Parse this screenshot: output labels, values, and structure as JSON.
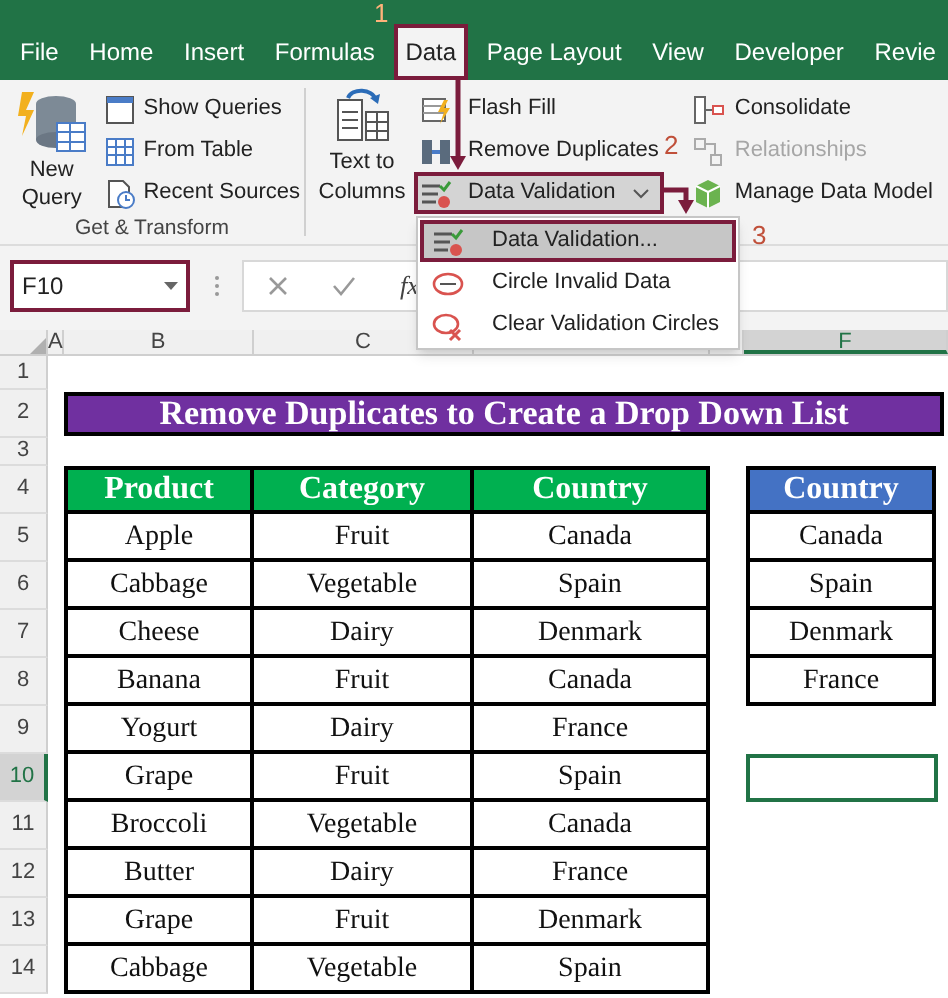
{
  "ribbon_tabs": [
    {
      "label": "File",
      "selected": false
    },
    {
      "label": "Home",
      "selected": false
    },
    {
      "label": "Insert",
      "selected": false
    },
    {
      "label": "Formulas",
      "selected": false
    },
    {
      "label": "Data",
      "selected": true
    },
    {
      "label": "Page Layout",
      "selected": false
    },
    {
      "label": "View",
      "selected": false
    },
    {
      "label": "Developer",
      "selected": false
    },
    {
      "label": "Revie",
      "selected": false
    }
  ],
  "get_transform": {
    "big_button": "New Query",
    "label": "Get & Transform",
    "commands": [
      {
        "label": "Show Queries",
        "kind": "queries"
      },
      {
        "label": "From Table",
        "kind": "table"
      },
      {
        "label": "Recent Sources",
        "kind": "recent"
      }
    ]
  },
  "data_tools": {
    "big_button": "Text to Columns",
    "commands": [
      {
        "label": "Flash Fill",
        "kind": "flash",
        "disabled": false,
        "highlighted": false,
        "has_menu": false
      },
      {
        "label": "Remove Duplicates",
        "kind": "dedupe",
        "disabled": false,
        "highlighted": false,
        "has_menu": false
      },
      {
        "label": "Data Validation",
        "kind": "validation",
        "disabled": false,
        "highlighted": true,
        "has_menu": true
      },
      {
        "label": "Consolidate",
        "kind": "consolidate",
        "disabled": false,
        "highlighted": false,
        "has_menu": false
      },
      {
        "label": "Relationships",
        "kind": "relationships",
        "disabled": true,
        "highlighted": false,
        "has_menu": false
      },
      {
        "label": "Manage Data Model",
        "kind": "model",
        "disabled": false,
        "highlighted": false,
        "has_menu": false
      }
    ]
  },
  "dropdown_menu": {
    "items": [
      {
        "label": "Data Validation...",
        "kind": "validate",
        "selected": true
      },
      {
        "label": "Circle Invalid Data",
        "kind": "circle",
        "selected": false
      },
      {
        "label": "Clear Validation Circles",
        "kind": "clear",
        "selected": false
      }
    ]
  },
  "annotations": [
    {
      "label": "1"
    },
    {
      "label": "2"
    },
    {
      "label": "3"
    }
  ],
  "formula_bar": {
    "name_box": "F10",
    "function_label": "fx"
  },
  "sheet": {
    "columns": [
      {
        "label": "A",
        "selected": false
      },
      {
        "label": "B",
        "selected": false
      },
      {
        "label": "C",
        "selected": false
      },
      {
        "selected": false
      },
      {
        "selected": false
      },
      {
        "label": "F",
        "selected": true
      }
    ],
    "rows": [
      {
        "label": "1",
        "selected": false
      },
      {
        "label": "2",
        "selected": false
      },
      {
        "label": "3",
        "selected": false
      },
      {
        "label": "4",
        "selected": false
      },
      {
        "label": "5",
        "selected": false
      },
      {
        "label": "6",
        "selected": false
      },
      {
        "label": "7",
        "selected": false
      },
      {
        "label": "8",
        "selected": false
      },
      {
        "label": "9",
        "selected": false
      },
      {
        "label": "10",
        "selected": true
      },
      {
        "label": "11",
        "selected": false
      },
      {
        "label": "12",
        "selected": false
      },
      {
        "label": "13",
        "selected": false
      },
      {
        "label": "14",
        "selected": false
      }
    ],
    "title": "Remove Duplicates to Create a Drop Down List",
    "main_table": {
      "columns": [
        "Product",
        "Category",
        "Country"
      ],
      "rows": [
        [
          "Apple",
          "Fruit",
          "Canada"
        ],
        [
          "Cabbage",
          "Vegetable",
          "Spain"
        ],
        [
          "Cheese",
          "Dairy",
          "Denmark"
        ],
        [
          "Banana",
          "Fruit",
          "Canada"
        ],
        [
          "Yogurt",
          "Dairy",
          "France"
        ],
        [
          "Grape",
          "Fruit",
          "Spain"
        ],
        [
          "Broccoli",
          "Vegetable",
          "Canada"
        ],
        [
          "Butter",
          "Dairy",
          "France"
        ],
        [
          "Grape",
          "Fruit",
          "Denmark"
        ],
        [
          "Cabbage",
          "Vegetable",
          "Spain"
        ]
      ]
    },
    "lookup_table": {
      "column": "Country",
      "rows": [
        "Canada",
        "Spain",
        "Denmark",
        "France"
      ]
    }
  }
}
